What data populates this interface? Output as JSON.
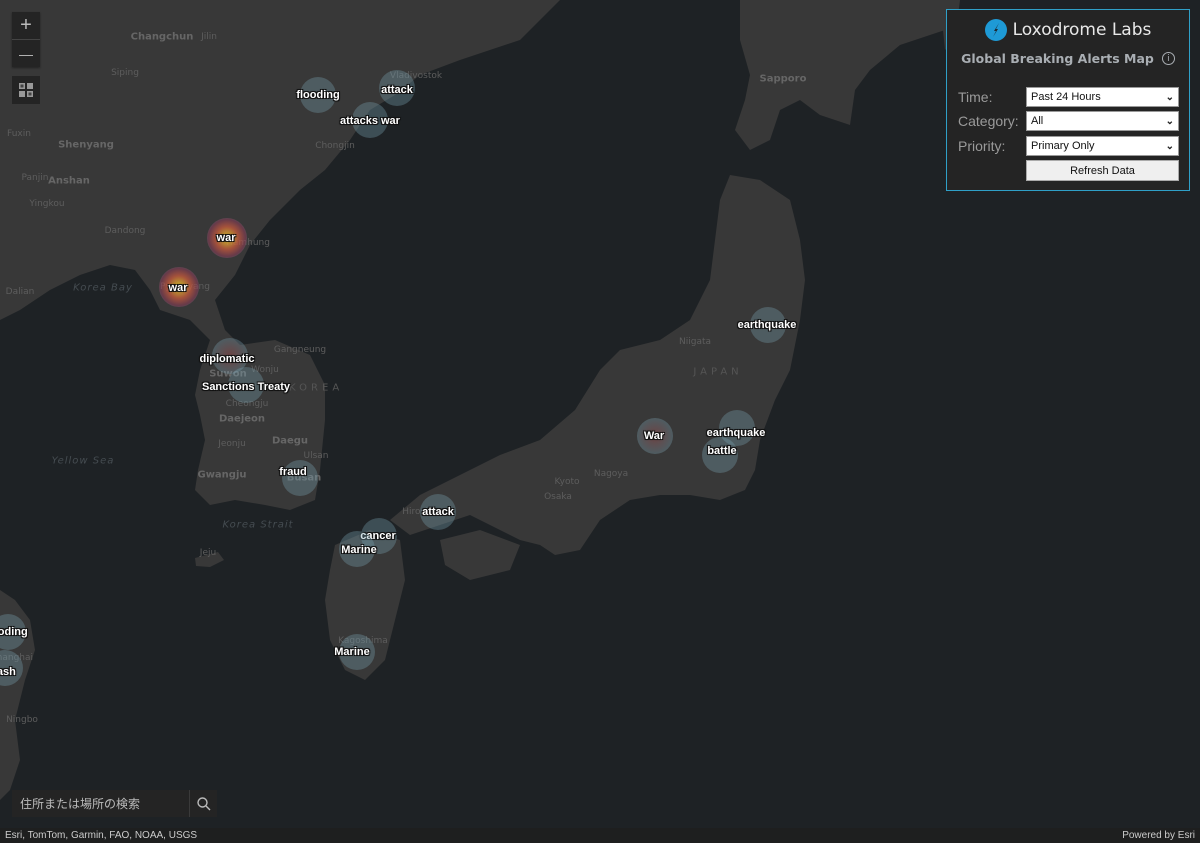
{
  "panel": {
    "brand_name": "Loxodrome Labs",
    "subtitle": "Global Breaking Alerts Map",
    "accent_color": "#2fa0c8",
    "filters": [
      {
        "label": "Time:",
        "value": "Past 24 Hours"
      },
      {
        "label": "Category:",
        "value": "All"
      },
      {
        "label": "Priority:",
        "value": "Primary Only"
      }
    ],
    "refresh_label": "Refresh Data"
  },
  "controls": {
    "zoom_in": "+",
    "zoom_out": "—"
  },
  "search": {
    "placeholder": "住所または場所の検索"
  },
  "attribution": {
    "sources": "Esri, TomTom, Garmin, FAO, NOAA, USGS",
    "powered_by": "Powered by Esri"
  },
  "places": [
    {
      "name": "Changchun",
      "cls": "big"
    },
    {
      "name": "Jilin",
      "cls": ""
    },
    {
      "name": "Siping",
      "cls": ""
    },
    {
      "name": "Fuxin",
      "cls": ""
    },
    {
      "name": "Shenyang",
      "cls": "big"
    },
    {
      "name": "Panjin",
      "cls": ""
    },
    {
      "name": "Anshan",
      "cls": "big"
    },
    {
      "name": "Yingkou",
      "cls": ""
    },
    {
      "name": "Dandong",
      "cls": ""
    },
    {
      "name": "Dalian",
      "cls": ""
    },
    {
      "name": "Korea Bay",
      "cls": "water"
    },
    {
      "name": "Vladivostok",
      "cls": ""
    },
    {
      "name": "Chongjin",
      "cls": ""
    },
    {
      "name": "Hamhung",
      "cls": ""
    },
    {
      "name": "Pyongyang",
      "cls": ""
    },
    {
      "name": "Gangneung",
      "cls": ""
    },
    {
      "name": "Wonju",
      "cls": ""
    },
    {
      "name": "Suwon",
      "cls": "big"
    },
    {
      "name": "SOUTH KOREA",
      "cls": "country"
    },
    {
      "name": "Cheongju",
      "cls": ""
    },
    {
      "name": "Daejeon",
      "cls": "big"
    },
    {
      "name": "Jeonju",
      "cls": ""
    },
    {
      "name": "Daegu",
      "cls": "big"
    },
    {
      "name": "Ulsan",
      "cls": ""
    },
    {
      "name": "Gwangju",
      "cls": "big"
    },
    {
      "name": "Busan",
      "cls": "big"
    },
    {
      "name": "Yellow Sea",
      "cls": "water"
    },
    {
      "name": "Korea Strait",
      "cls": "water"
    },
    {
      "name": "Jeju",
      "cls": ""
    },
    {
      "name": "Sapporo",
      "cls": "big"
    },
    {
      "name": "Niigata",
      "cls": ""
    },
    {
      "name": "JAPAN",
      "cls": "country"
    },
    {
      "name": "Nagoya",
      "cls": ""
    },
    {
      "name": "Kyoto",
      "cls": ""
    },
    {
      "name": "Osaka",
      "cls": ""
    },
    {
      "name": "Hiroshima",
      "cls": ""
    },
    {
      "name": "Kagoshima",
      "cls": ""
    },
    {
      "name": "Shanghai",
      "cls": ""
    },
    {
      "name": "Ningbo",
      "cls": ""
    }
  ],
  "alerts": [
    {
      "label": "flooding",
      "intensity": "plain"
    },
    {
      "label": "attack",
      "intensity": "plain"
    },
    {
      "label": "attacks war",
      "intensity": "plain"
    },
    {
      "label": "war",
      "intensity": "hot"
    },
    {
      "label": "war",
      "intensity": "hot"
    },
    {
      "label": "diplomatic",
      "intensity": "warm"
    },
    {
      "label": "Sanctions Treaty",
      "intensity": "plain"
    },
    {
      "label": "fraud",
      "intensity": "plain"
    },
    {
      "label": "attack",
      "intensity": "plain"
    },
    {
      "label": "cancer",
      "intensity": "plain"
    },
    {
      "label": "Marine",
      "intensity": "plain"
    },
    {
      "label": "Marine",
      "intensity": "plain"
    },
    {
      "label": "earthquake",
      "intensity": "plain"
    },
    {
      "label": "War",
      "intensity": "warm"
    },
    {
      "label": "earthquake",
      "intensity": "plain"
    },
    {
      "label": "battle",
      "intensity": "plain"
    },
    {
      "label": "flooding",
      "intensity": "plain"
    },
    {
      "label": "flash",
      "intensity": "plain"
    }
  ]
}
